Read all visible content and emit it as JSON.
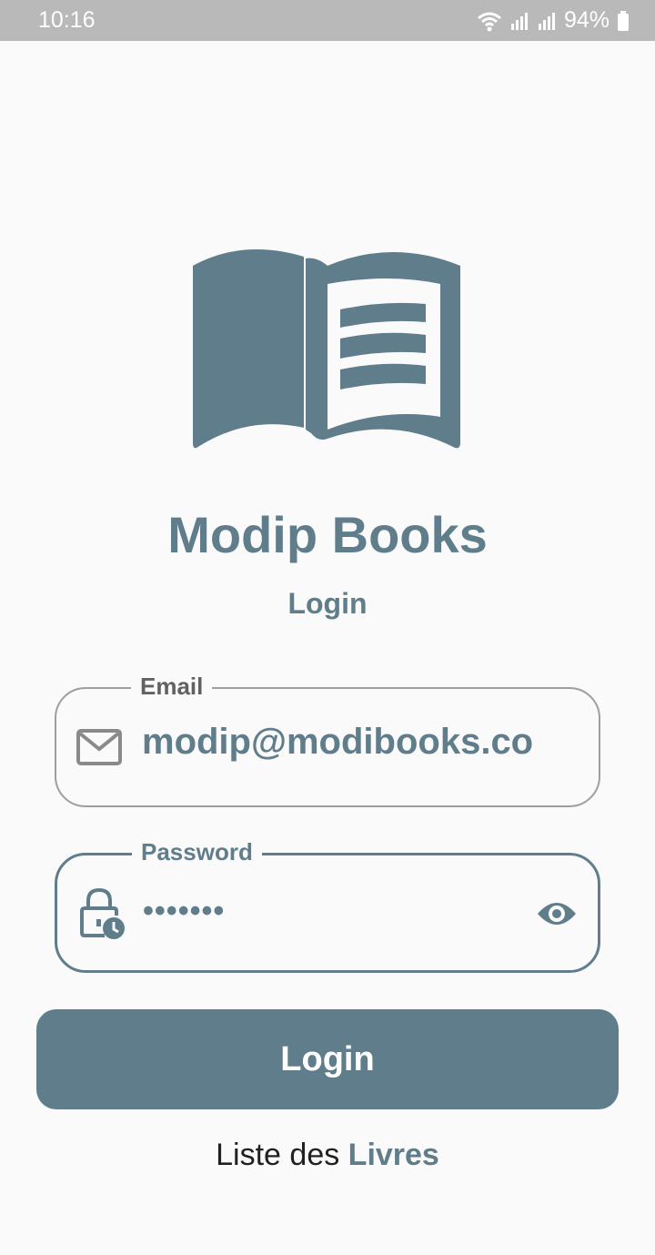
{
  "status_bar": {
    "time": "10:16",
    "battery": "94%",
    "icons": [
      "wifi-icon",
      "signal-icon",
      "signal-icon",
      "battery-icon"
    ]
  },
  "logo": {
    "icon": "open-book-icon",
    "color": "#607d8b"
  },
  "app_title": "Modip Books",
  "page_subtitle": "Login",
  "email_field": {
    "label": "Email",
    "value": "modip@modibooks.co",
    "icon": "mail-icon"
  },
  "password_field": {
    "label": "Password",
    "value": "•••••••",
    "icon": "lock-clock-icon",
    "toggle_icon": "eye-icon"
  },
  "login_button": {
    "label": "Login"
  },
  "footer": {
    "prefix": "Liste des ",
    "link": "Livres"
  },
  "colors": {
    "accent": "#607d8b",
    "background": "#fafafa",
    "status_bar": "#b9b9b9"
  }
}
